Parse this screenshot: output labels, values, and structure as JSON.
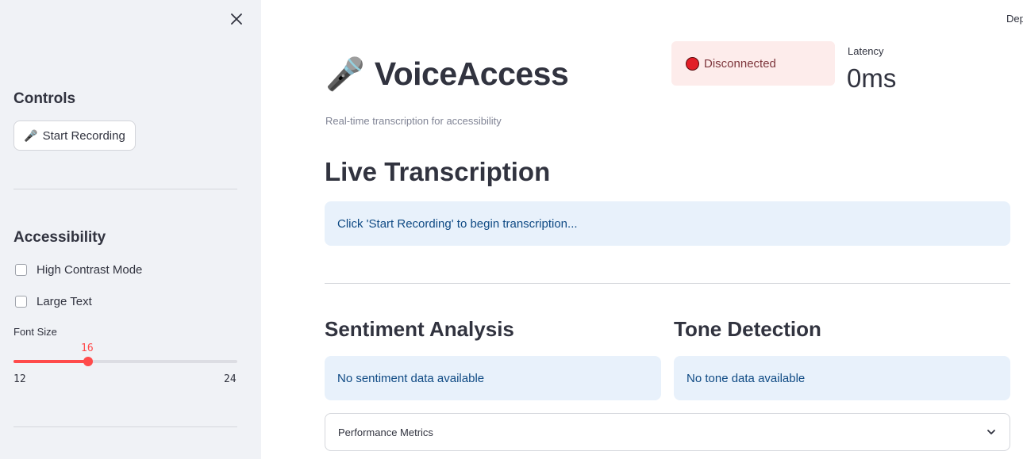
{
  "sidebar": {
    "controls_heading": "Controls",
    "start_button_icon": "🎤",
    "start_button_label": "Start Recording",
    "accessibility_heading": "Accessibility",
    "checkboxes": [
      {
        "label": "High Contrast Mode",
        "checked": false
      },
      {
        "label": "Large Text",
        "checked": false
      }
    ],
    "font_size": {
      "label": "Font Size",
      "value": "16",
      "min": "12",
      "max": "24",
      "fraction": 0.333
    }
  },
  "header": {
    "deploy_label": "Deploy",
    "title_icon": "🎤",
    "title": "VoiceAccess",
    "subtitle": "Real-time transcription for accessibility"
  },
  "status": {
    "text": "Disconnected",
    "color": "#e21e27"
  },
  "latency": {
    "label": "Latency",
    "value": "0ms"
  },
  "transcription": {
    "heading": "Live Transcription",
    "message": "Click 'Start Recording' to begin transcription..."
  },
  "sentiment": {
    "heading": "Sentiment Analysis",
    "message": "No sentiment data available"
  },
  "tone": {
    "heading": "Tone Detection",
    "message": "No tone data available"
  },
  "metrics": {
    "label": "Performance Metrics",
    "icon": "chevron-down-icon"
  },
  "colors": {
    "accent": "#ff4b4b",
    "info_bg": "#e8f1fb",
    "info_text": "#0f4a84",
    "error_bg": "#fdeceb"
  }
}
